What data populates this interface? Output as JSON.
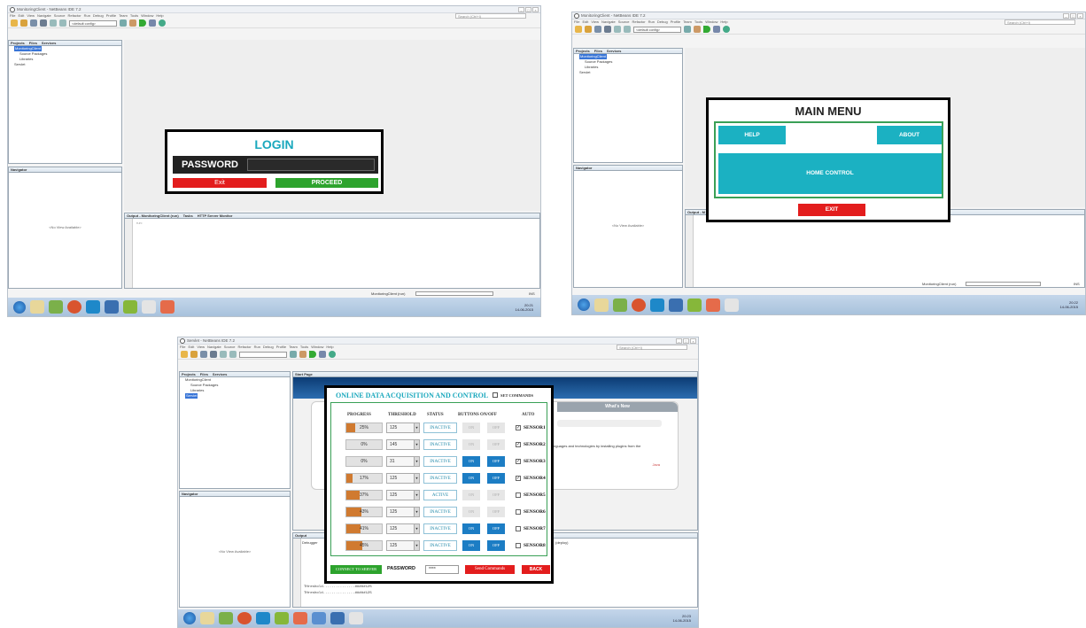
{
  "screens": {
    "login": {
      "window_title": "MonitoringClient - NetBeans IDE 7.2",
      "menu": [
        "File",
        "Edit",
        "View",
        "Navigate",
        "Source",
        "Refactor",
        "Run",
        "Debug",
        "Profile",
        "Team",
        "Tools",
        "Window",
        "Help"
      ],
      "search_placeholder": "Search (Ctrl+I)",
      "config": "<default config>",
      "projects_tabs": [
        "Projects",
        "Files",
        "Services"
      ],
      "tree": [
        "MonitoringClient",
        "Source Packages",
        "Libraries",
        "Servlet"
      ],
      "navigator": "Navigator",
      "no_view": "<No View Available>",
      "output_tabs": [
        "Output - MonitoringClient (run)",
        "Tasks",
        "HTTP Server Monitor"
      ],
      "output_text": "run:",
      "status_text": "MonitoringClient (run)",
      "ins": "INS",
      "dialog": {
        "title": "LOGIN",
        "password_label": "PASSWORD",
        "exit": "Exit",
        "proceed": "PROCEED"
      },
      "clock": {
        "time": "20:21",
        "date": "14-06-2015"
      }
    },
    "menu": {
      "window_title": "MonitoringClient - NetBeans IDE 7.2",
      "menu": [
        "File",
        "Edit",
        "View",
        "Navigate",
        "Source",
        "Refactor",
        "Run",
        "Debug",
        "Profile",
        "Team",
        "Tools",
        "Window",
        "Help"
      ],
      "search_placeholder": "Search (Ctrl+I)",
      "config": "<default config>",
      "projects_tabs": [
        "Projects",
        "Files",
        "Services"
      ],
      "tree": [
        "MonitoringClient",
        "Source Packages",
        "Libraries",
        "Servlet"
      ],
      "navigator": "Navigator",
      "no_view": "<No View Available>",
      "output_label": "Output - M",
      "status_text": "MonitoringClient (run)",
      "ins": "INS",
      "dialog": {
        "title": "MAIN MENU",
        "help": "HELP",
        "about": "ABOUT",
        "home_control": "HOME CONTROL",
        "exit": "EXIT"
      },
      "clock": {
        "time": "20:22",
        "date": "14-06-2015"
      }
    },
    "acquisition": {
      "window_title": "Servlet - NetBeans IDE 7.2",
      "menu": [
        "File",
        "Edit",
        "View",
        "Navigate",
        "Source",
        "Refactor",
        "Run",
        "Debug",
        "Profile",
        "Team",
        "Tools",
        "Window",
        "Help"
      ],
      "search_placeholder": "Search (Ctrl+I)",
      "projects_tabs": [
        "Projects",
        "Files",
        "Services"
      ],
      "tree": [
        "MonitoringClient",
        "Source Packages",
        "Libraries",
        "Servlet"
      ],
      "navigator": "Navigator",
      "no_view": "<No View Available>",
      "start_page_tab": "Start Page",
      "whats_new": "What's New",
      "start_text": "nguages and technologies by installing plugins from the",
      "java_label": "Java",
      "output_label": "Output",
      "debugger_label": "Debugger",
      "deploy_label": "(deploy)",
      "output_lines": [
        "THreshold...............#####125",
        "THreshold...............#####125"
      ],
      "status_text": "MonitoringClient (run)",
      "ins": "INS",
      "clock": {
        "time": "20:23",
        "date": "14-06-2015"
      },
      "dialog": {
        "title": "ONLINE DATA ACQUISITION AND CONTROL",
        "set_commands": "SET COMMANDS",
        "headers": {
          "progress": "PROGRESS",
          "threshold": "THRESHOLD",
          "status": "STATUS",
          "buttons": "BUTTONS ON/OFF",
          "auto": "AUTO"
        },
        "rows": [
          {
            "progress": "25%",
            "level": 0.25,
            "threshold": "125",
            "status": "INACTIVE",
            "enabled": false,
            "auto": true,
            "sensor": "SENSOR1"
          },
          {
            "progress": "0%",
            "level": 0.0,
            "threshold": "145",
            "status": "INACTIVE",
            "enabled": false,
            "auto": true,
            "sensor": "SENSOR2"
          },
          {
            "progress": "0%",
            "level": 0.0,
            "threshold": "31",
            "status": "INACTIVE",
            "enabled": true,
            "auto": true,
            "sensor": "SENSOR3"
          },
          {
            "progress": "17%",
            "level": 0.17,
            "threshold": "125",
            "status": "INACTIVE",
            "enabled": true,
            "auto": true,
            "sensor": "SENSOR4"
          },
          {
            "progress": "37%",
            "level": 0.37,
            "threshold": "125",
            "status": "ACTIVE",
            "enabled": false,
            "auto": false,
            "sensor": "SENSOR5"
          },
          {
            "progress": "43%",
            "level": 0.43,
            "threshold": "125",
            "status": "INACTIVE",
            "enabled": false,
            "auto": false,
            "sensor": "SENSOR6"
          },
          {
            "progress": "41%",
            "level": 0.41,
            "threshold": "125",
            "status": "INACTIVE",
            "enabled": true,
            "auto": false,
            "sensor": "SENSOR7"
          },
          {
            "progress": "45%",
            "level": 0.45,
            "threshold": "125",
            "status": "INACTIVE",
            "enabled": true,
            "auto": false,
            "sensor": "SENSOR8"
          }
        ],
        "on_label": "ON",
        "off_label": "OFF",
        "connect": "CONNECT TO SERVER",
        "password_label": "PASSWORD",
        "password_value": "****",
        "send": "Send Commands",
        "back": "BACK"
      }
    }
  },
  "colors": {
    "teal": "#1bb1c2",
    "red": "#e31d1d",
    "green": "#2da32d",
    "orange": "#d07a30",
    "blue": "#1c7dc4"
  }
}
